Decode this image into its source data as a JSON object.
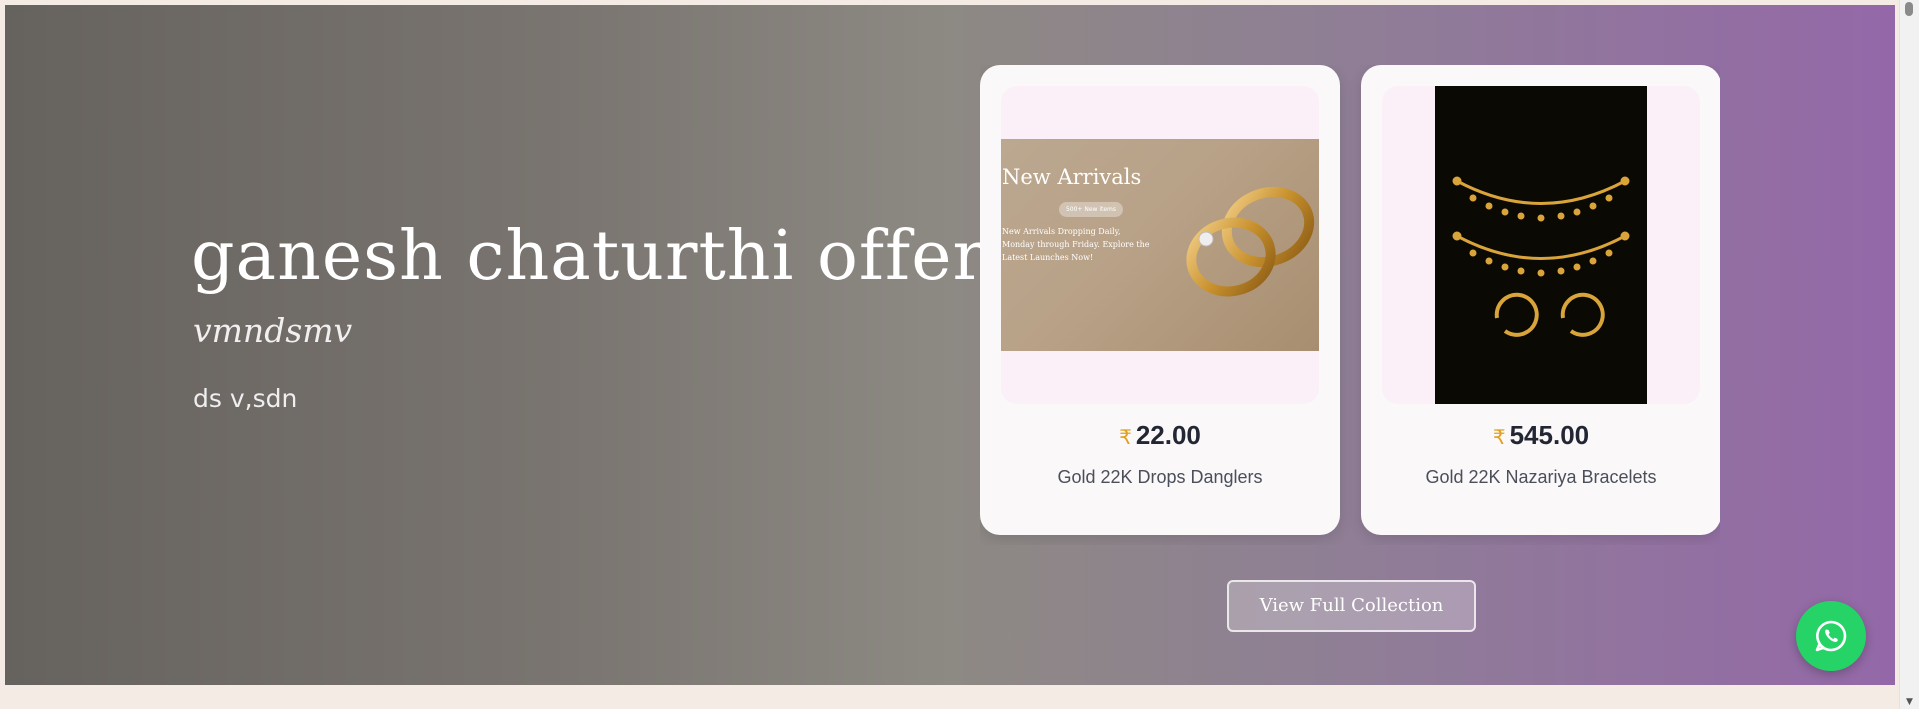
{
  "hero": {
    "title": "ganesh chaturthi offer",
    "subtitle": "vmndsmv",
    "description": "ds v,sdn"
  },
  "products": [
    {
      "currency": "₹",
      "price": "22.00",
      "name": "Gold 22K Drops Danglers",
      "banner_title": "New Arrivals",
      "banner_badge": "500+ New items",
      "banner_text": "New Arrivals Dropping Daily, Monday through Friday. Explore the Latest Launches Now!"
    },
    {
      "currency": "₹",
      "price": "545.00",
      "name": "Gold 22K Nazariya Bracelets"
    }
  ],
  "view_collection_label": "View Full Collection",
  "whatsapp_icon": "whatsapp-icon",
  "colors": {
    "gradient_start": "#66625e",
    "gradient_end": "#9468a8",
    "whatsapp": "#25d366",
    "rupee": "#e2a020"
  }
}
